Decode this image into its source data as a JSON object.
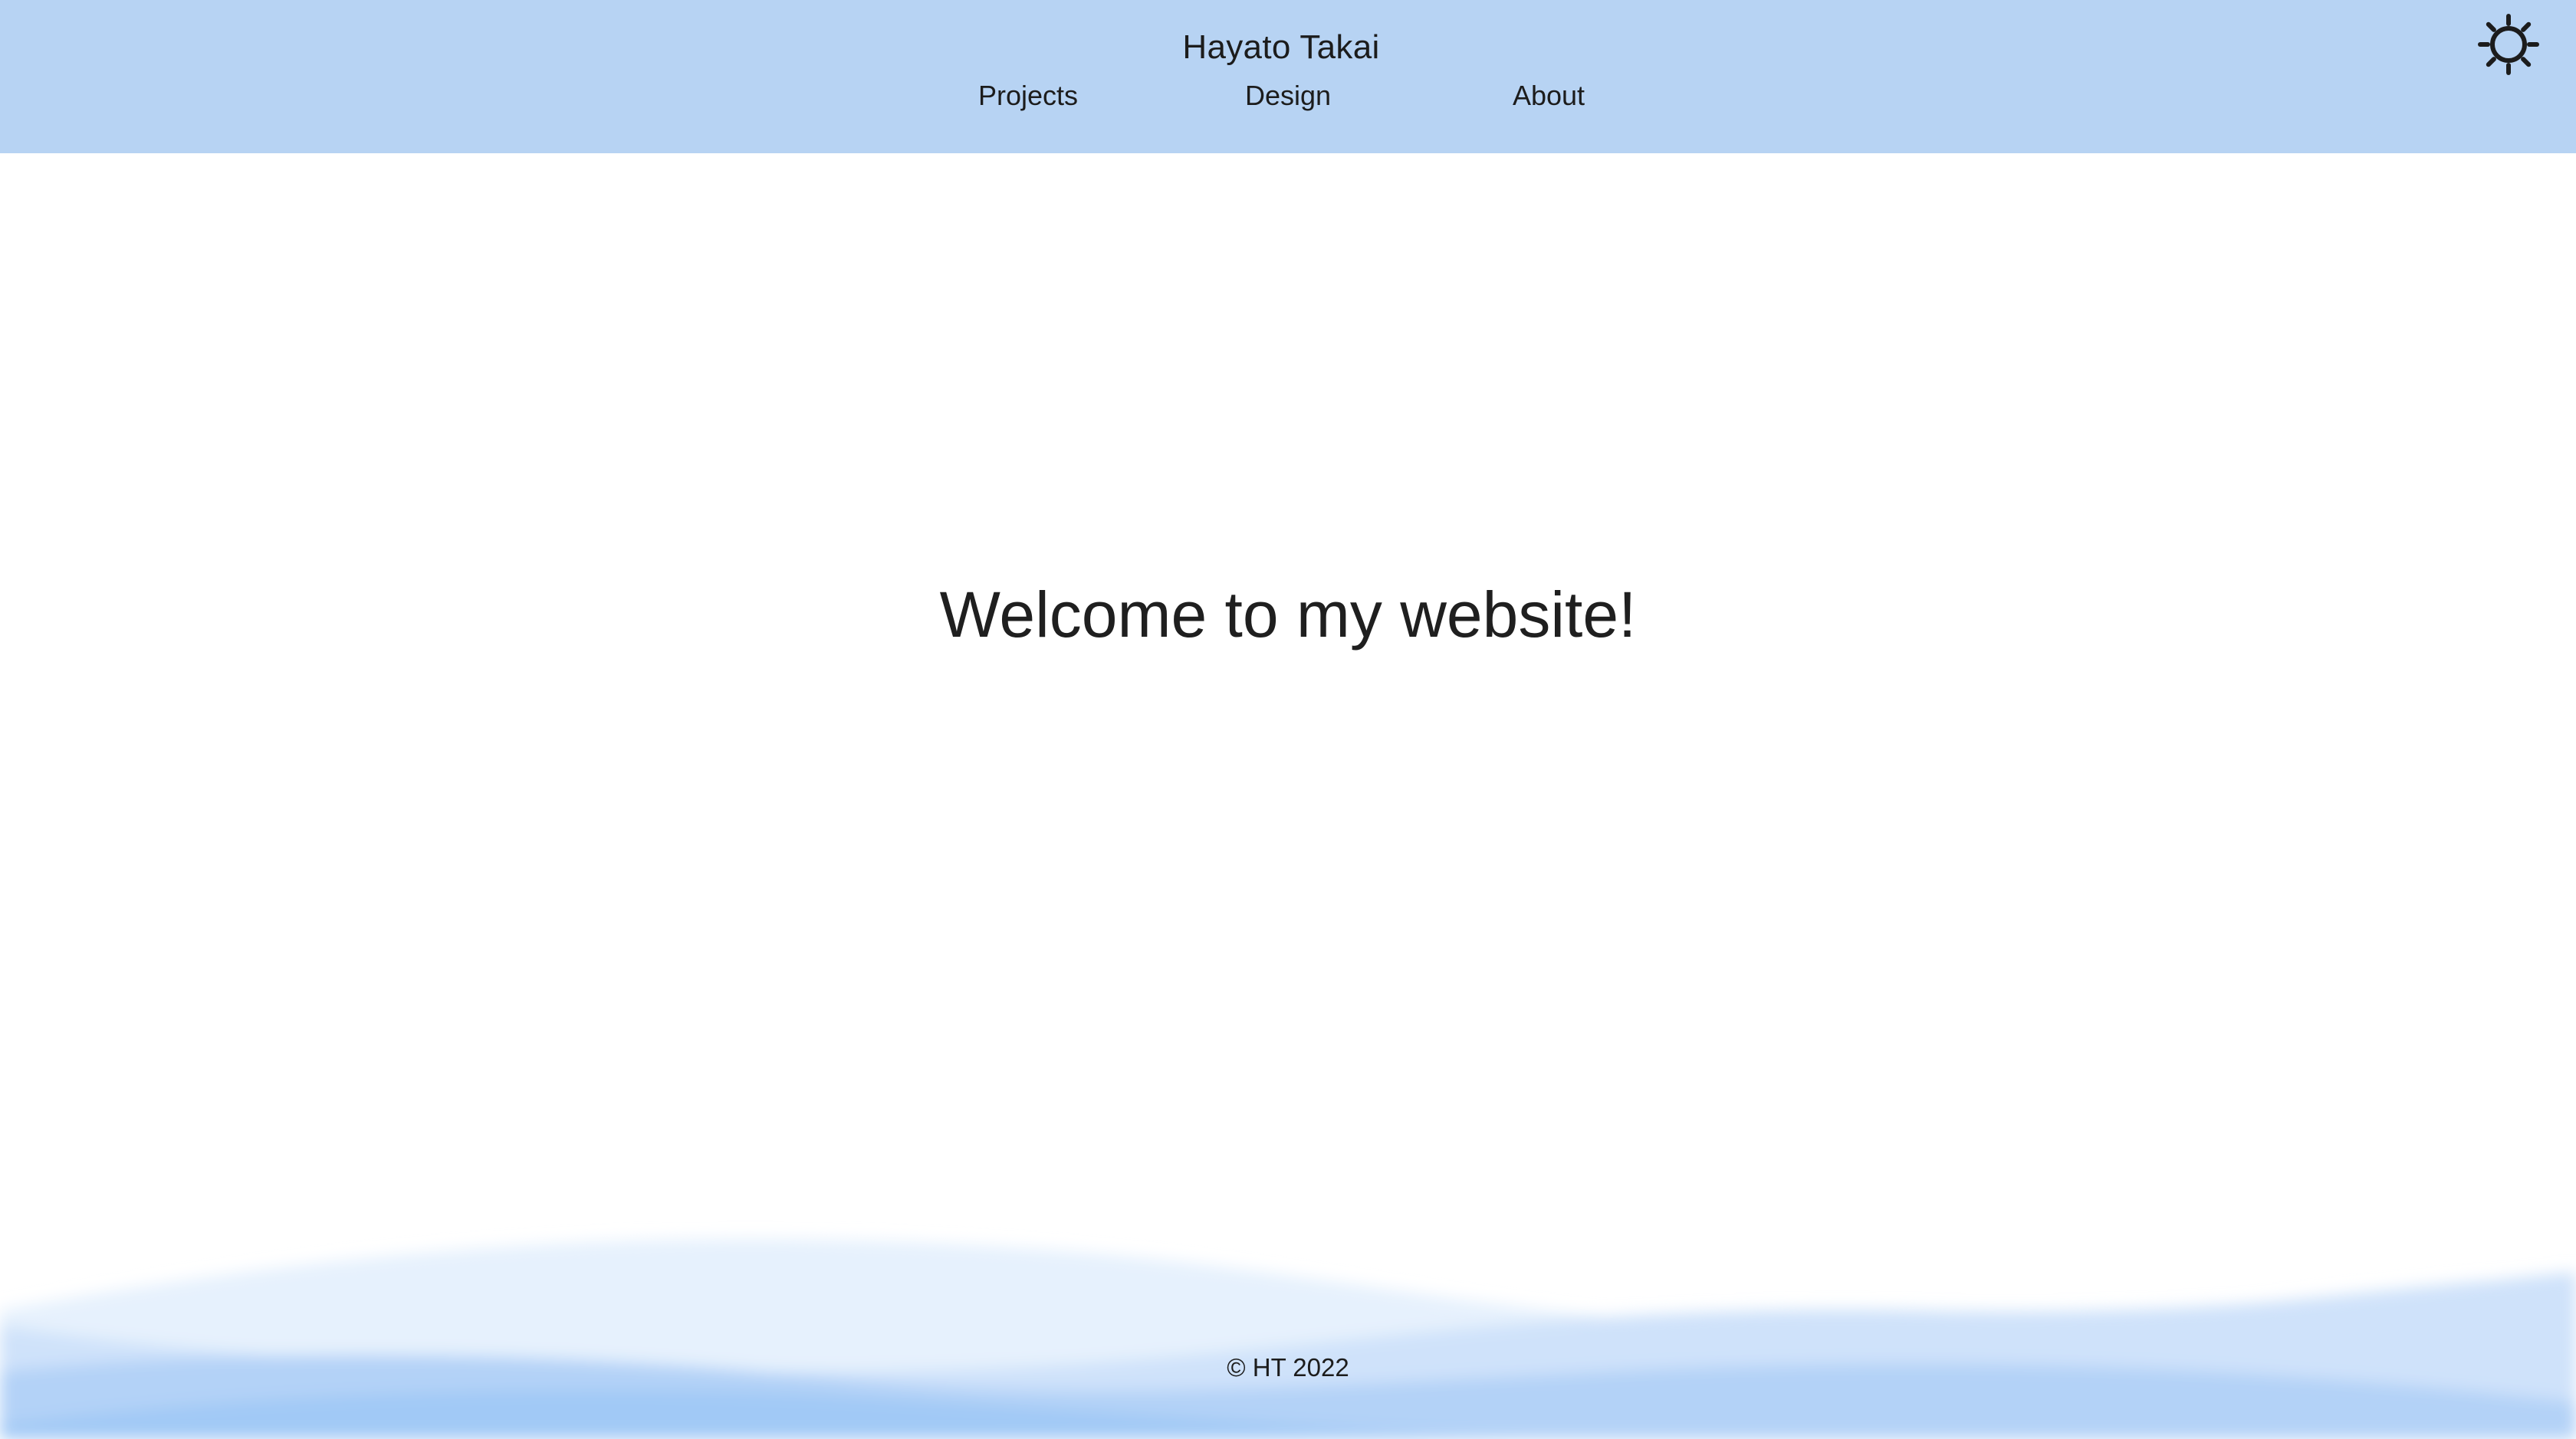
{
  "header": {
    "title": "Hayato Takai",
    "nav": [
      {
        "label": "Projects"
      },
      {
        "label": "Design"
      },
      {
        "label": "About"
      }
    ],
    "theme_toggle_icon": "sun-icon",
    "background_color": "#b7d3f3"
  },
  "main": {
    "heading": "Welcome to my website!"
  },
  "footer": {
    "text": "© HT 2022",
    "wave_colors": [
      "#e6f1fd",
      "#cfe2fa",
      "#b3d2f7",
      "#a1c9f6"
    ]
  }
}
